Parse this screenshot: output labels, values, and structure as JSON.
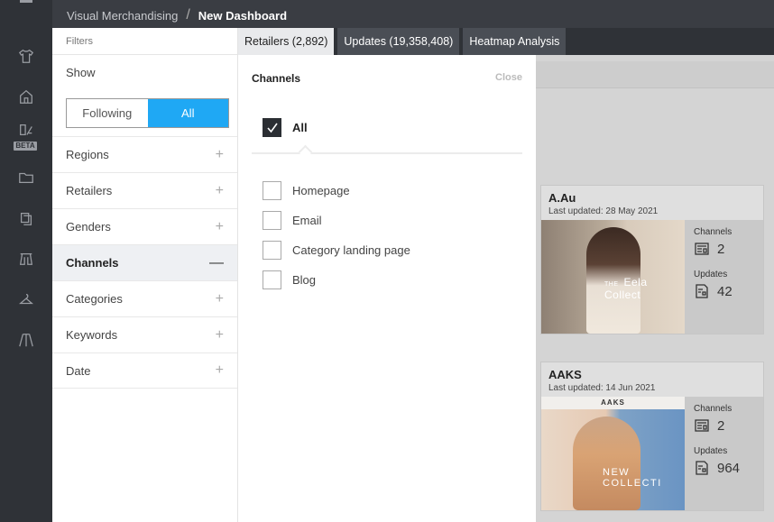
{
  "breadcrumb": {
    "parent": "Visual Merchandising",
    "current": "New Dashboard"
  },
  "rail": {
    "icons": [
      "menu-icon",
      "shirt-icon",
      "store-icon",
      "beta-feature-icon",
      "folder-icon",
      "copy-icon",
      "clothes-rack-icon",
      "hanger-icon",
      "runway-icon"
    ],
    "beta_label": "BETA"
  },
  "sidebar": {
    "header": "Filters",
    "show_label": "Show",
    "toggle": {
      "following": "Following",
      "all": "All",
      "selected": "All"
    },
    "facets": [
      {
        "label": "Regions",
        "sign": "+"
      },
      {
        "label": "Retailers",
        "sign": "+"
      },
      {
        "label": "Genders",
        "sign": "+"
      },
      {
        "label": "Channels",
        "sign": "—",
        "active": true
      },
      {
        "label": "Categories",
        "sign": "+"
      },
      {
        "label": "Keywords",
        "sign": "+"
      },
      {
        "label": "Date",
        "sign": "+"
      }
    ]
  },
  "tabs": [
    {
      "label": "Retailers (2,892)",
      "active": true
    },
    {
      "label": "Updates (19,358,408)",
      "active": false
    },
    {
      "label": "Heatmap Analysis",
      "active": false
    }
  ],
  "channels_panel": {
    "title": "Channels",
    "close_label": "Close",
    "all_option": {
      "label": "All",
      "checked": true
    },
    "options": [
      {
        "label": "Homepage",
        "checked": false
      },
      {
        "label": "Email",
        "checked": false
      },
      {
        "label": "Category landing page",
        "checked": false
      },
      {
        "label": "Blog",
        "checked": false
      }
    ]
  },
  "cards": [
    {
      "name": "A.Au",
      "updated": "Last updated: 28 May 2021",
      "channels_label": "Channels",
      "channels": "2",
      "updates_label": "Updates",
      "updates": "42",
      "image_text_small": "THE",
      "image_text": "Eela Collect"
    },
    {
      "name": "AAKS",
      "updated": "Last updated: 14 Jun 2021",
      "channels_label": "Channels",
      "channels": "2",
      "updates_label": "Updates",
      "updates": "964",
      "image_nav": "AAKS",
      "image_text": "NEW COLLECTI"
    }
  ],
  "colors": {
    "accent": "#1fa8f4",
    "rail": "#2f3237",
    "topbar": "#3a3d43",
    "checked": "#2b2e33"
  }
}
